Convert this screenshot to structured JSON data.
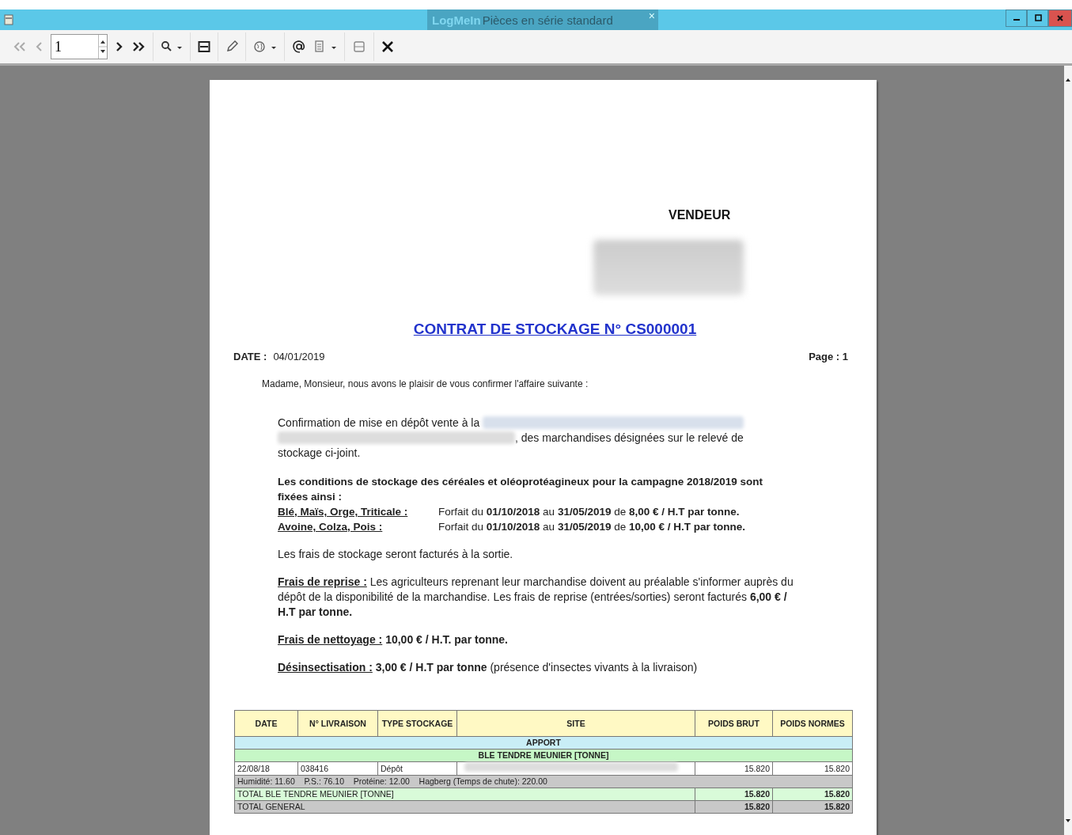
{
  "window": {
    "app_tab": "LogMeIn",
    "title": "Pièces en série standard",
    "tab_close": "×"
  },
  "toolbar": {
    "page_value": "1"
  },
  "document": {
    "vendeur": "VENDEUR",
    "contract_title": "CONTRAT DE STOCKAGE N° CS000001",
    "date_label": "DATE :",
    "date_value": "04/01/2019",
    "page": "Page : 1",
    "intro": "Madame, Monsieur, nous avons le plaisir de vous confirmer l'affaire suivante :",
    "confirmation": {
      "line_1": "Confirmation de mise en dépôt vente à la",
      "line_2": ", des marchandises désignées sur le relevé de",
      "line_3": "stockage ci-joint."
    },
    "conditions_heading": "Les conditions de stockage des céréales et oléoprotéagineux pour la campagne 2018/2019 sont fixées ainsi :",
    "rates": [
      {
        "product": "Blé, Maïs, Orge, Triticale :",
        "terms": "Forfait du **01/10/2018** au **31/05/2019** de **8,00 € / H.T par tonne.**"
      },
      {
        "product": "Avoine, Colza, Pois :",
        "terms": "Forfait du **01/10/2018** au **31/05/2019** de **10,00 € / H.T par tonne.**"
      }
    ],
    "sortie": "Les frais de stockage seront facturés à la sortie.",
    "fees": [
      {
        "label": "Frais de reprise :",
        "text": "Les agriculteurs reprenant leur marchandise doivent au préalable s'informer auprès du dépôt de la disponibilité de la marchandise. Les frais de reprise (entrées/sorties) seront facturés **6,00 € / H.T par tonne.**"
      },
      {
        "label": "Frais de nettoyage :",
        "text": "**10,00 € / H.T. par tonne.**"
      },
      {
        "label": "Désinsectisation :",
        "text": "**3,00 € / H.T par tonne** (présence d'insectes vivants à la livraison)"
      }
    ]
  },
  "table": {
    "columns": [
      "DATE",
      "N° LIVRAISON",
      "TYPE STOCKAGE",
      "SITE",
      "POIDS BRUT",
      "POIDS NORMES"
    ],
    "section": "APPORT",
    "group": "BLE TENDRE MEUNIER [TONNE]",
    "rows": [
      {
        "date": "22/08/18",
        "livraison": "038416",
        "type": "Dépôt",
        "poids_brut": "15.820",
        "poids_normes": "15.820",
        "detail": "Humidité: 11.60    P.S.: 76.10    Protéine: 12.00    Hagberg (Temps de chute): 220.00"
      }
    ],
    "totals": [
      {
        "kind": "group",
        "label": "TOTAL BLE TENDRE MEUNIER [TONNE]",
        "poids_brut": "15.820",
        "poids_normes": "15.820"
      },
      {
        "kind": "general",
        "label": "TOTAL GENERAL",
        "poids_brut": "15.820",
        "poids_normes": "15.820"
      }
    ]
  }
}
